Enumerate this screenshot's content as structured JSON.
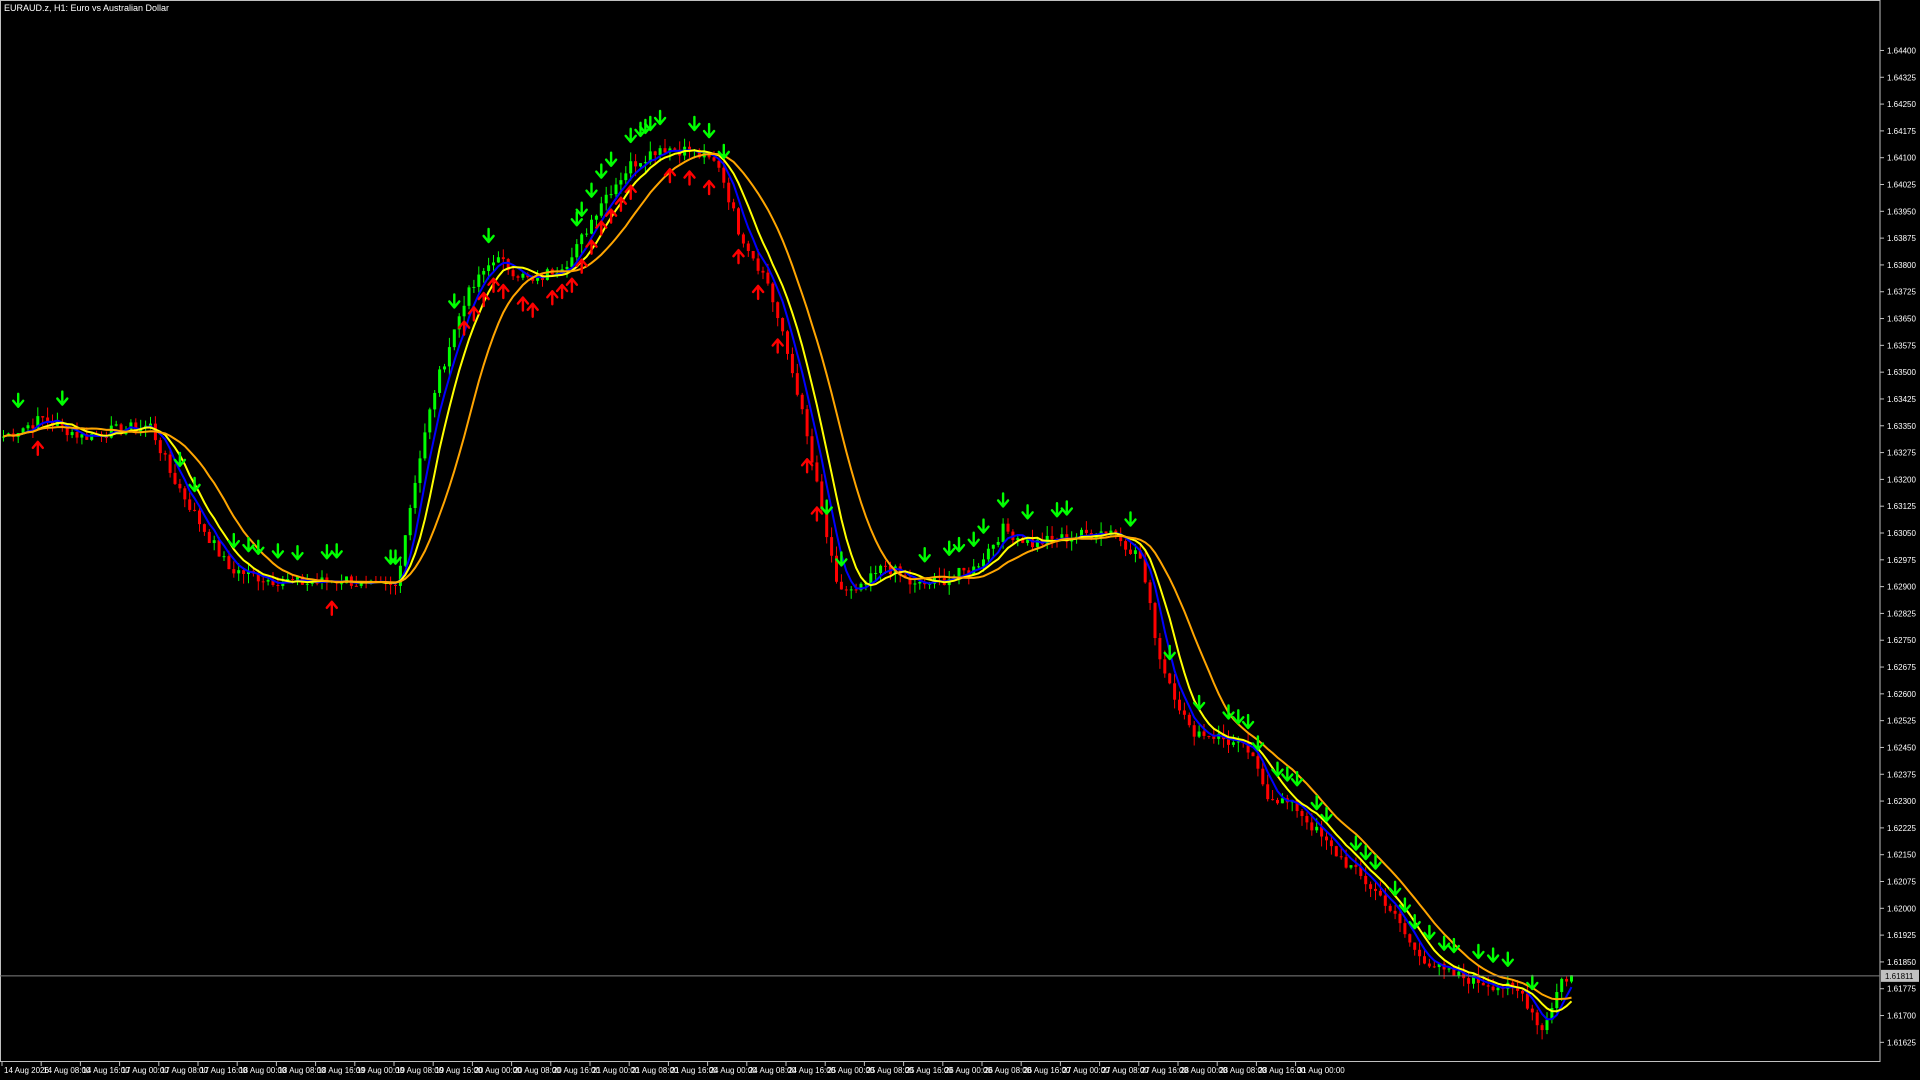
{
  "chart_title": "EURAUD.z, H1:  Euro vs Australian Dollar",
  "colors": {
    "background": "#000000",
    "frame": "#c0c0c0",
    "bull_candle": "#00ff00",
    "bear_candle": "#ff0000",
    "ma_fast": "#0000ff",
    "ma_mid": "#ffff00",
    "ma_slow": "#ffa500",
    "arrow_up": "#ff0000",
    "arrow_down": "#00ff00",
    "price_line": "#808080",
    "price_tag_bg": "#c0c0c0"
  },
  "chart_data": {
    "type": "candlestick",
    "symbol": "EURAUD.z",
    "timeframe": "H1",
    "description": "Euro vs Australian Dollar",
    "current_price": "1.61811",
    "ylim": [
      1.6157,
      1.6453
    ],
    "y_ticks": [
      "1.64400",
      "1.64325",
      "1.64250",
      "1.64175",
      "1.64100",
      "1.64025",
      "1.63950",
      "1.63875",
      "1.63800",
      "1.63725",
      "1.63650",
      "1.63575",
      "1.63500",
      "1.63425",
      "1.63350",
      "1.63275",
      "1.63200",
      "1.63125",
      "1.63050",
      "1.62975",
      "1.62900",
      "1.62825",
      "1.62750",
      "1.62675",
      "1.62600",
      "1.62525",
      "1.62450",
      "1.62375",
      "1.62300",
      "1.62225",
      "1.62150",
      "1.62075",
      "1.62000",
      "1.61925",
      "1.61850",
      "1.61775",
      "1.61700",
      "1.61625"
    ],
    "x_ticks": [
      "14 Aug 2026",
      "14 Aug 08:00",
      "14 Aug 16:00",
      "17 Aug 00:00",
      "17 Aug 08:00",
      "17 Aug 16:00",
      "18 Aug 00:00",
      "18 Aug 08:00",
      "18 Aug 16:00",
      "19 Aug 00:00",
      "19 Aug 08:00",
      "19 Aug 16:00",
      "20 Aug 00:00",
      "20 Aug 08:00",
      "20 Aug 16:00",
      "21 Aug 00:00",
      "21 Aug 08:00",
      "21 Aug 16:00",
      "24 Aug 00:00",
      "24 Aug 08:00",
      "24 Aug 16:00",
      "25 Aug 00:00",
      "25 Aug 08:00",
      "25 Aug 16:00",
      "26 Aug 00:00",
      "26 Aug 08:00",
      "26 Aug 16:00",
      "27 Aug 00:00",
      "27 Aug 08:00",
      "27 Aug 16:00",
      "28 Aug 00:00",
      "28 Aug 08:00",
      "28 Aug 16:00",
      "31 Aug 00:00"
    ],
    "x_tick_bar_step": 8,
    "close_path": [
      [
        0,
        1.6332
      ],
      [
        8,
        1.6337
      ],
      [
        16,
        1.6332
      ],
      [
        24,
        1.6334
      ],
      [
        30,
        1.6335
      ],
      [
        34,
        1.6322
      ],
      [
        40,
        1.6308
      ],
      [
        46,
        1.6295
      ],
      [
        54,
        1.6292
      ],
      [
        62,
        1.6291
      ],
      [
        70,
        1.6292
      ],
      [
        74,
        1.629
      ],
      [
        80,
        1.629
      ],
      [
        84,
        1.632
      ],
      [
        88,
        1.6345
      ],
      [
        94,
        1.637
      ],
      [
        100,
        1.6382
      ],
      [
        108,
        1.6375
      ],
      [
        116,
        1.6382
      ],
      [
        122,
        1.6398
      ],
      [
        128,
        1.6408
      ],
      [
        134,
        1.6413
      ],
      [
        140,
        1.6412
      ],
      [
        146,
        1.6408
      ],
      [
        150,
        1.639
      ],
      [
        156,
        1.6375
      ],
      [
        162,
        1.6345
      ],
      [
        166,
        1.6318
      ],
      [
        170,
        1.629
      ],
      [
        174,
        1.6288
      ],
      [
        180,
        1.6296
      ],
      [
        186,
        1.629
      ],
      [
        192,
        1.6292
      ],
      [
        198,
        1.6295
      ],
      [
        204,
        1.6306
      ],
      [
        210,
        1.6302
      ],
      [
        218,
        1.6304
      ],
      [
        226,
        1.6306
      ],
      [
        232,
        1.6298
      ],
      [
        236,
        1.627
      ],
      [
        242,
        1.625
      ],
      [
        248,
        1.6248
      ],
      [
        254,
        1.6244
      ],
      [
        258,
        1.6232
      ],
      [
        264,
        1.6228
      ],
      [
        270,
        1.6218
      ],
      [
        276,
        1.621
      ],
      [
        282,
        1.6202
      ],
      [
        288,
        1.6188
      ],
      [
        294,
        1.6182
      ],
      [
        300,
        1.618
      ],
      [
        306,
        1.6178
      ],
      [
        310,
        1.6176
      ],
      [
        314,
        1.6166
      ],
      [
        318,
        1.618
      ],
      [
        320,
        1.6181
      ]
    ],
    "signals": {
      "down_arrow_bars": [
        3,
        12,
        36,
        39,
        47,
        50,
        52,
        56,
        60,
        66,
        68,
        79,
        80,
        92,
        99,
        117,
        118,
        120,
        122,
        124,
        128,
        130,
        131,
        132,
        134,
        141,
        144,
        147,
        168,
        171,
        188,
        193,
        195,
        198,
        200,
        204,
        209,
        215,
        217,
        230,
        238,
        244,
        250,
        252,
        254,
        256,
        260,
        262,
        264,
        268,
        270,
        276,
        278,
        280,
        284,
        286,
        288,
        291,
        294,
        296,
        301,
        304,
        307,
        312
      ],
      "up_arrow_bars": [
        7,
        67,
        94,
        96,
        98,
        100,
        102,
        106,
        108,
        112,
        114,
        116,
        118,
        120,
        122,
        124,
        126,
        128,
        136,
        140,
        144,
        150,
        154,
        158,
        164,
        166
      ]
    }
  }
}
